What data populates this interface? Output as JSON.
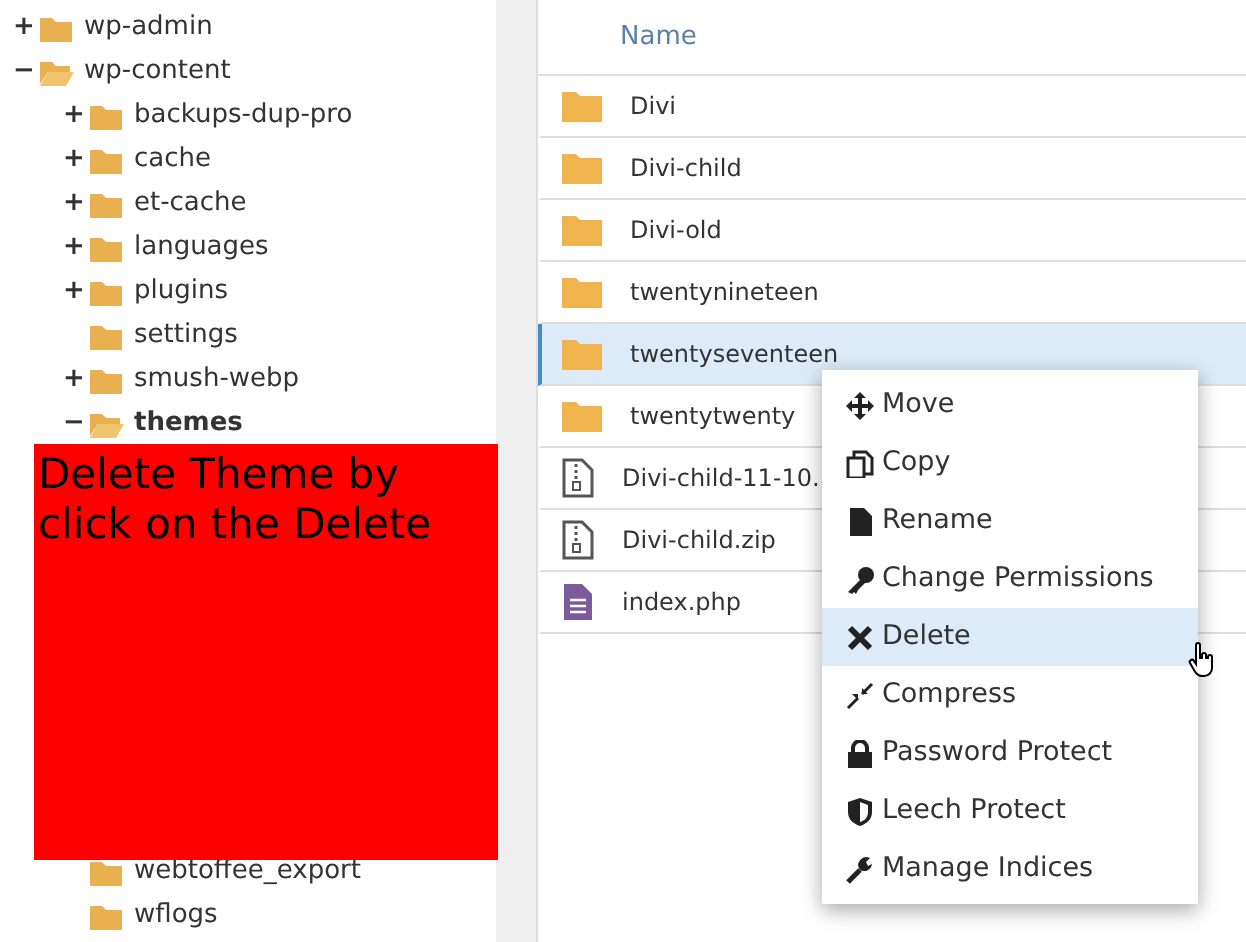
{
  "tree": [
    {
      "label": "wp-admin",
      "expanded": false,
      "toggle": "+",
      "selected": false
    },
    {
      "label": "wp-content",
      "expanded": true,
      "toggle": "−",
      "selected": false,
      "children": [
        {
          "label": "backups-dup-pro",
          "expanded": false,
          "toggle": "+",
          "selected": false
        },
        {
          "label": "cache",
          "expanded": false,
          "toggle": "+",
          "selected": false
        },
        {
          "label": "et-cache",
          "expanded": false,
          "toggle": "+",
          "selected": false
        },
        {
          "label": "languages",
          "expanded": false,
          "toggle": "+",
          "selected": false
        },
        {
          "label": "plugins",
          "expanded": false,
          "toggle": "+",
          "selected": false
        },
        {
          "label": "settings",
          "expanded": false,
          "selected": false
        },
        {
          "label": "smush-webp",
          "expanded": false,
          "toggle": "+",
          "selected": false
        },
        {
          "label": "themes",
          "expanded": true,
          "toggle": "−",
          "selected": true
        },
        {
          "label": "webtoffee_export",
          "expanded": false,
          "selected": false
        },
        {
          "label": "wflogs",
          "expanded": false,
          "selected": false
        }
      ]
    }
  ],
  "callout": {
    "text": "Delete Theme by click on the Delete"
  },
  "table": {
    "columns": [
      "Name"
    ],
    "rows": [
      {
        "kind": "folder",
        "name": "Divi",
        "selected": false
      },
      {
        "kind": "folder",
        "name": "Divi-child",
        "selected": false
      },
      {
        "kind": "folder",
        "name": "Divi-old",
        "selected": false
      },
      {
        "kind": "folder",
        "name": "twentynineteen",
        "selected": false
      },
      {
        "kind": "folder",
        "name": "twentyseventeen",
        "selected": true
      },
      {
        "kind": "folder",
        "name": "twentytwenty",
        "selected": false
      },
      {
        "kind": "archive",
        "name": "Divi-child-11-10.",
        "selected": false
      },
      {
        "kind": "archive",
        "name": "Divi-child.zip",
        "selected": false
      },
      {
        "kind": "document",
        "name": "index.php",
        "selected": false
      }
    ]
  },
  "context_menu": {
    "items": [
      {
        "kind": "move",
        "label": "Move",
        "selected": false
      },
      {
        "kind": "copy",
        "label": "Copy",
        "selected": false
      },
      {
        "kind": "rename",
        "label": "Rename",
        "selected": false
      },
      {
        "kind": "permissions",
        "label": "Change Permissions",
        "selected": false
      },
      {
        "kind": "delete",
        "label": "Delete",
        "selected": true
      },
      {
        "kind": "compress",
        "label": "Compress",
        "selected": false
      },
      {
        "kind": "password",
        "label": "Password Protect",
        "selected": false
      },
      {
        "kind": "leech",
        "label": "Leech Protect",
        "selected": false
      },
      {
        "kind": "indices",
        "label": "Manage Indices",
        "selected": false
      }
    ]
  }
}
